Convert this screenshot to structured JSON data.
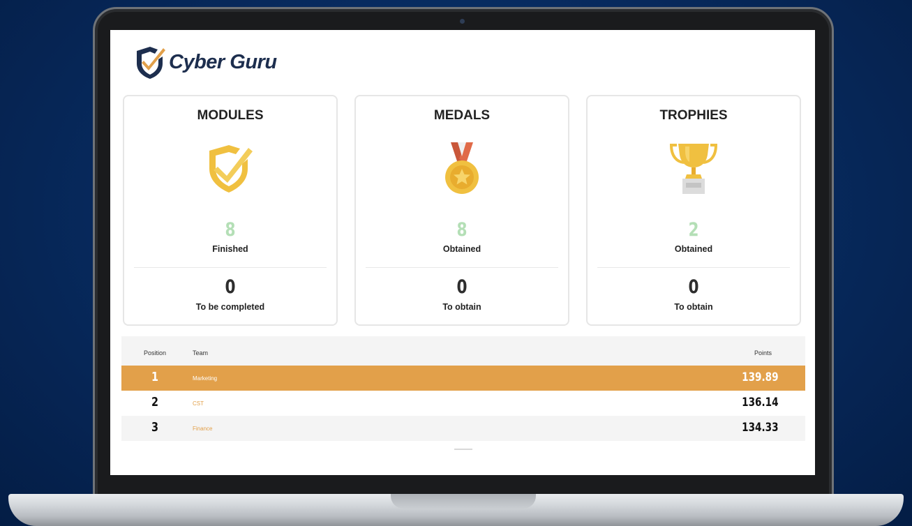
{
  "app": {
    "brand": "Cyber Guru"
  },
  "cards": [
    {
      "title": "MODULES",
      "icon": "shield-check-icon",
      "top_value": "8",
      "top_label": "Finished",
      "bottom_value": "0",
      "bottom_label": "To be completed"
    },
    {
      "title": "MEDALS",
      "icon": "medal-icon",
      "top_value": "8",
      "top_label": "Obtained",
      "bottom_value": "0",
      "bottom_label": "To obtain"
    },
    {
      "title": "TROPHIES",
      "icon": "trophy-icon",
      "top_value": "2",
      "top_label": "Obtained",
      "bottom_value": "0",
      "bottom_label": "To obtain"
    }
  ],
  "leaderboard": {
    "columns": {
      "position": "Position",
      "team": "Team",
      "points": "Points"
    },
    "rows": [
      {
        "position": "1",
        "team": "Marketing",
        "points": "139.89"
      },
      {
        "position": "2",
        "team": "CST",
        "points": "136.14"
      },
      {
        "position": "3",
        "team": "Finance",
        "points": "134.33"
      }
    ]
  },
  "colors": {
    "accent": "#e2a04a",
    "brand_navy": "#1d2e4e",
    "positive_green": "#b4dfb6",
    "icon_gold": "#f0c040",
    "background_blue": "#07295c"
  }
}
